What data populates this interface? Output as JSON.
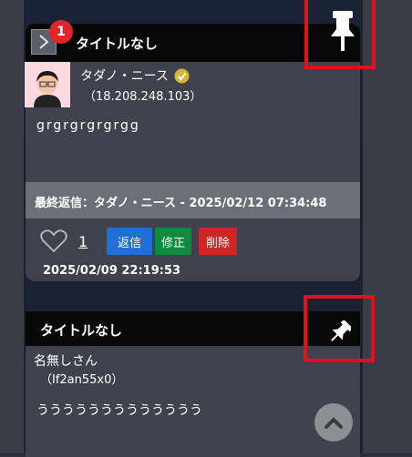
{
  "post1": {
    "badge_count": "1",
    "title": "タイトルなし",
    "author": "タダノ・ニース",
    "ip": "（18.208.248.103）",
    "message": "grgrgrgrgrgg",
    "last_reply": "最終返信：タダノ・ニース - 2025/02/12 07:34:48",
    "like_count": "1",
    "reply_label": "返信",
    "edit_label": "修正",
    "delete_label": "削除",
    "date": "2025/02/09 22:19:53"
  },
  "post2": {
    "title": "タイトルなし",
    "author": "名無しさん",
    "ip": "（If2an55x0）",
    "message": "ううううううううううううう"
  },
  "colors": {
    "reply_button": "#1f6fd6",
    "edit_button": "#0f8a3f",
    "delete_button": "#cf2525",
    "badge": "#e0252b",
    "highlight_box": "#e3101a"
  }
}
